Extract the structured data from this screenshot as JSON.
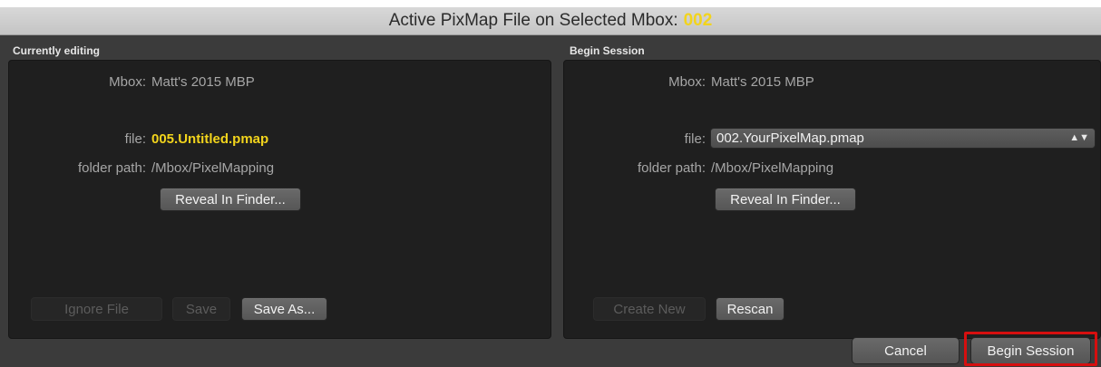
{
  "title": {
    "text": "Active PixMap File on Selected Mbox:",
    "mbox_number": "002"
  },
  "left_panel": {
    "section_label": "Currently editing",
    "mbox_label": "Mbox:",
    "mbox_value": "Matt's 2015 MBP",
    "file_label": "file:",
    "file_value": "005.Untitled.pmap",
    "folder_label": "folder path:",
    "folder_value": "/Mbox/PixelMapping",
    "reveal_button": "Reveal In Finder...",
    "ignore_button": "Ignore File",
    "save_button": "Save",
    "save_as_button": "Save As..."
  },
  "right_panel": {
    "section_label": "Begin Session",
    "mbox_label": "Mbox:",
    "mbox_value": "Matt's 2015 MBP",
    "file_label": "file:",
    "file_selected": "002.YourPixelMap.pmap",
    "folder_label": "folder path:",
    "folder_value": "/Mbox/PixelMapping",
    "reveal_button": "Reveal In Finder...",
    "create_new_button": "Create New",
    "rescan_button": "Rescan"
  },
  "footer": {
    "cancel_button": "Cancel",
    "begin_session_button": "Begin Session"
  },
  "colors": {
    "accent_yellow": "#f2d41c",
    "highlight_red": "#d60f0f"
  }
}
